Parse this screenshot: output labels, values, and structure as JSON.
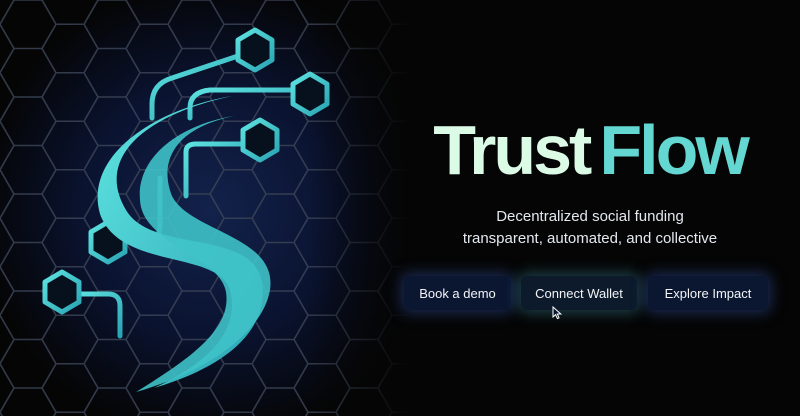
{
  "hero": {
    "brand_word1": "Trust",
    "brand_word2": "Flow",
    "tagline_line1": "Decentralized social funding",
    "tagline_line2": "transparent, automated, and collective"
  },
  "buttons": {
    "demo": "Book a demo",
    "wallet": "Connect Wallet",
    "impact": "Explore Impact"
  },
  "colors": {
    "background": "#050505",
    "brand_light": "#dcfbe6",
    "brand_accent": "#64d7d2",
    "button_bg": "#0b1631"
  },
  "icons": {
    "logo": "trustflow-s-circuit-logo",
    "cursor": "mouse-pointer-icon"
  }
}
